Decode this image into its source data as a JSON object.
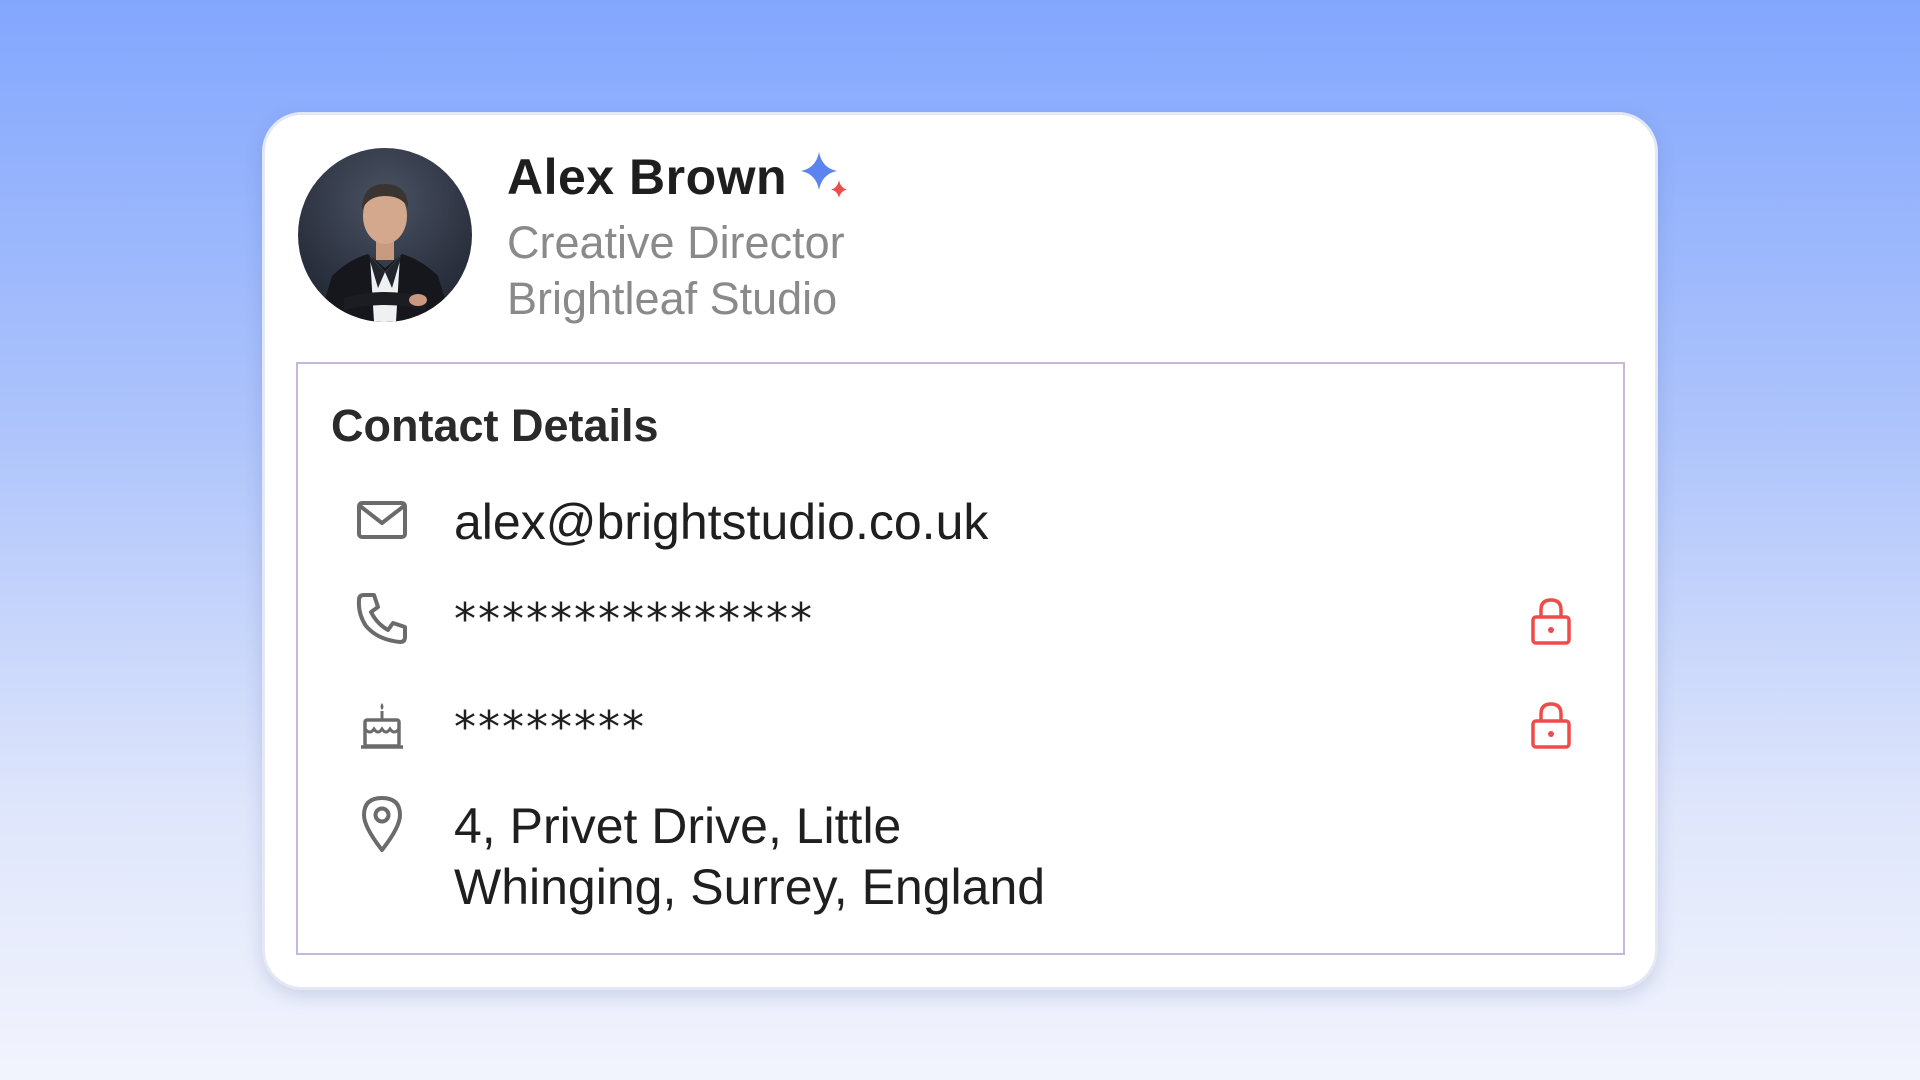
{
  "profile": {
    "name": "Alex Brown",
    "title": "Creative Director",
    "company": "Brightleaf Studio",
    "avatar_icon": "profile-photo",
    "badge_icon": "sparkle-icon"
  },
  "contact": {
    "heading": "Contact Details",
    "email": {
      "icon": "mail-icon",
      "value": "alex@brightstudio.co.uk"
    },
    "phone": {
      "icon": "phone-icon",
      "value": "***************",
      "locked": true,
      "lock_icon": "lock-icon"
    },
    "birthday": {
      "icon": "birthday-cake-icon",
      "value": "********",
      "locked": true,
      "lock_icon": "lock-icon"
    },
    "address": {
      "icon": "location-pin-icon",
      "line1": "4, Privet Drive, Little",
      "line2": "Whinging, Surrey, England"
    }
  },
  "colors": {
    "lock": "#ee4b4b",
    "icon": "#6b6b6b",
    "section_border": "#c9b6dc",
    "sparkle_blue": "#5b84f0",
    "sparkle_red": "#ee4b4b"
  }
}
